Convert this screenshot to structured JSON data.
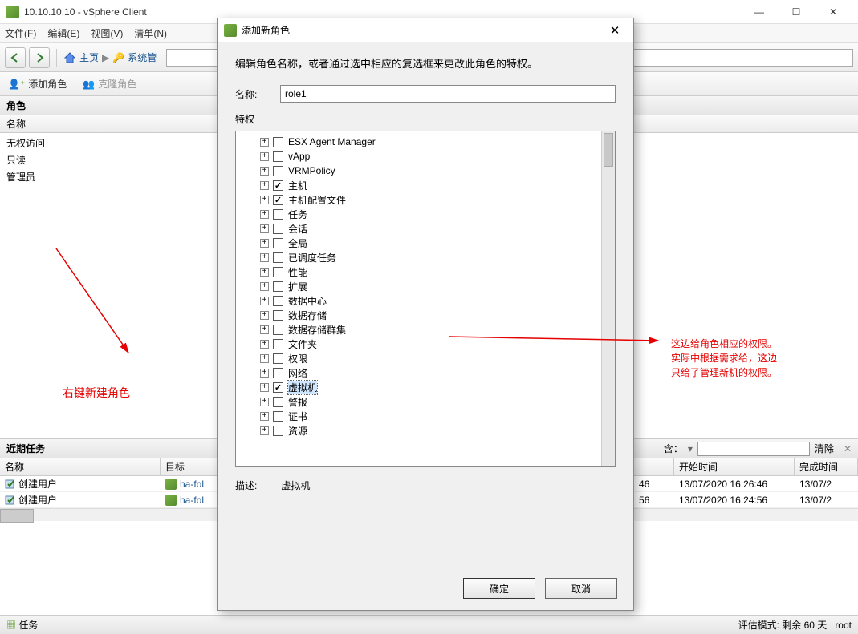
{
  "window": {
    "title": "10.10.10.10 - vSphere Client"
  },
  "menu": {
    "file": "文件(F)",
    "edit": "编辑(E)",
    "view": "视图(V)",
    "inventory": "清单(N)"
  },
  "nav": {
    "home": "主页",
    "sysmgmt": "系统管"
  },
  "rolebar": {
    "add": "添加角色",
    "clone": "克隆角色"
  },
  "roles": {
    "header": "角色",
    "col_name": "名称",
    "items": [
      "无权访问",
      "只读",
      "管理员"
    ]
  },
  "tasks": {
    "header": "近期任务",
    "filter_label": "含：",
    "clear": "清除",
    "cols": {
      "name": "名称",
      "target": "目标",
      "start": "开始时间",
      "end": "完成时间"
    },
    "rows": [
      {
        "name": "创建用户",
        "target": "ha-fol",
        "r1": "46",
        "start": "13/07/2020 16:26:46",
        "end": "13/07/2"
      },
      {
        "name": "创建用户",
        "target": "ha-fol",
        "r1": "56",
        "start": "13/07/2020 16:24:56",
        "end": "13/07/2"
      }
    ]
  },
  "status": {
    "tasks": "任务",
    "eval": "评估模式: 剩余 60 天",
    "user": "root"
  },
  "dialog": {
    "title": "添加新角色",
    "desc": "编辑角色名称，或者通过选中相应的复选框来更改此角色的特权。",
    "name_label": "名称:",
    "name_value": "role1",
    "priv_label": "特权",
    "tree": [
      {
        "label": "ESX Agent Manager",
        "checked": false
      },
      {
        "label": "vApp",
        "checked": false
      },
      {
        "label": "VRMPolicy",
        "checked": false
      },
      {
        "label": "主机",
        "checked": true
      },
      {
        "label": "主机配置文件",
        "checked": true
      },
      {
        "label": "任务",
        "checked": false
      },
      {
        "label": "会话",
        "checked": false
      },
      {
        "label": "全局",
        "checked": false
      },
      {
        "label": "已调度任务",
        "checked": false
      },
      {
        "label": "性能",
        "checked": false
      },
      {
        "label": "扩展",
        "checked": false
      },
      {
        "label": "数据中心",
        "checked": false
      },
      {
        "label": "数据存储",
        "checked": false
      },
      {
        "label": "数据存储群集",
        "checked": false
      },
      {
        "label": "文件夹",
        "checked": false
      },
      {
        "label": "权限",
        "checked": false
      },
      {
        "label": "网络",
        "checked": false
      },
      {
        "label": "虚拟机",
        "checked": true,
        "selected": true
      },
      {
        "label": "警报",
        "checked": false
      },
      {
        "label": "证书",
        "checked": false
      },
      {
        "label": "资源",
        "checked": false
      }
    ],
    "desc_label": "描述:",
    "desc_value": "虚拟机",
    "ok": "确定",
    "cancel": "取消"
  },
  "annotations": {
    "left": "右键新建角色",
    "right1": "这边给角色相应的权限。",
    "right2": "实际中根据需求给，这边",
    "right3": "只给了管理新机的权限。"
  }
}
